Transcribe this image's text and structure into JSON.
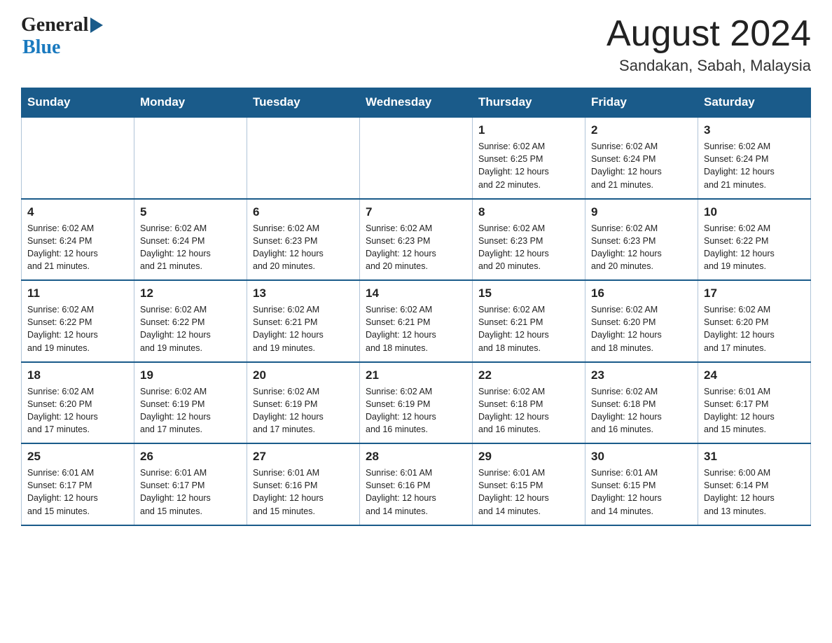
{
  "header": {
    "logo_general": "General",
    "logo_blue": "Blue",
    "month_year": "August 2024",
    "location": "Sandakan, Sabah, Malaysia"
  },
  "days_of_week": [
    "Sunday",
    "Monday",
    "Tuesday",
    "Wednesday",
    "Thursday",
    "Friday",
    "Saturday"
  ],
  "weeks": [
    {
      "days": [
        {
          "number": "",
          "info": ""
        },
        {
          "number": "",
          "info": ""
        },
        {
          "number": "",
          "info": ""
        },
        {
          "number": "",
          "info": ""
        },
        {
          "number": "1",
          "info": "Sunrise: 6:02 AM\nSunset: 6:25 PM\nDaylight: 12 hours\nand 22 minutes."
        },
        {
          "number": "2",
          "info": "Sunrise: 6:02 AM\nSunset: 6:24 PM\nDaylight: 12 hours\nand 21 minutes."
        },
        {
          "number": "3",
          "info": "Sunrise: 6:02 AM\nSunset: 6:24 PM\nDaylight: 12 hours\nand 21 minutes."
        }
      ]
    },
    {
      "days": [
        {
          "number": "4",
          "info": "Sunrise: 6:02 AM\nSunset: 6:24 PM\nDaylight: 12 hours\nand 21 minutes."
        },
        {
          "number": "5",
          "info": "Sunrise: 6:02 AM\nSunset: 6:24 PM\nDaylight: 12 hours\nand 21 minutes."
        },
        {
          "number": "6",
          "info": "Sunrise: 6:02 AM\nSunset: 6:23 PM\nDaylight: 12 hours\nand 20 minutes."
        },
        {
          "number": "7",
          "info": "Sunrise: 6:02 AM\nSunset: 6:23 PM\nDaylight: 12 hours\nand 20 minutes."
        },
        {
          "number": "8",
          "info": "Sunrise: 6:02 AM\nSunset: 6:23 PM\nDaylight: 12 hours\nand 20 minutes."
        },
        {
          "number": "9",
          "info": "Sunrise: 6:02 AM\nSunset: 6:23 PM\nDaylight: 12 hours\nand 20 minutes."
        },
        {
          "number": "10",
          "info": "Sunrise: 6:02 AM\nSunset: 6:22 PM\nDaylight: 12 hours\nand 19 minutes."
        }
      ]
    },
    {
      "days": [
        {
          "number": "11",
          "info": "Sunrise: 6:02 AM\nSunset: 6:22 PM\nDaylight: 12 hours\nand 19 minutes."
        },
        {
          "number": "12",
          "info": "Sunrise: 6:02 AM\nSunset: 6:22 PM\nDaylight: 12 hours\nand 19 minutes."
        },
        {
          "number": "13",
          "info": "Sunrise: 6:02 AM\nSunset: 6:21 PM\nDaylight: 12 hours\nand 19 minutes."
        },
        {
          "number": "14",
          "info": "Sunrise: 6:02 AM\nSunset: 6:21 PM\nDaylight: 12 hours\nand 18 minutes."
        },
        {
          "number": "15",
          "info": "Sunrise: 6:02 AM\nSunset: 6:21 PM\nDaylight: 12 hours\nand 18 minutes."
        },
        {
          "number": "16",
          "info": "Sunrise: 6:02 AM\nSunset: 6:20 PM\nDaylight: 12 hours\nand 18 minutes."
        },
        {
          "number": "17",
          "info": "Sunrise: 6:02 AM\nSunset: 6:20 PM\nDaylight: 12 hours\nand 17 minutes."
        }
      ]
    },
    {
      "days": [
        {
          "number": "18",
          "info": "Sunrise: 6:02 AM\nSunset: 6:20 PM\nDaylight: 12 hours\nand 17 minutes."
        },
        {
          "number": "19",
          "info": "Sunrise: 6:02 AM\nSunset: 6:19 PM\nDaylight: 12 hours\nand 17 minutes."
        },
        {
          "number": "20",
          "info": "Sunrise: 6:02 AM\nSunset: 6:19 PM\nDaylight: 12 hours\nand 17 minutes."
        },
        {
          "number": "21",
          "info": "Sunrise: 6:02 AM\nSunset: 6:19 PM\nDaylight: 12 hours\nand 16 minutes."
        },
        {
          "number": "22",
          "info": "Sunrise: 6:02 AM\nSunset: 6:18 PM\nDaylight: 12 hours\nand 16 minutes."
        },
        {
          "number": "23",
          "info": "Sunrise: 6:02 AM\nSunset: 6:18 PM\nDaylight: 12 hours\nand 16 minutes."
        },
        {
          "number": "24",
          "info": "Sunrise: 6:01 AM\nSunset: 6:17 PM\nDaylight: 12 hours\nand 15 minutes."
        }
      ]
    },
    {
      "days": [
        {
          "number": "25",
          "info": "Sunrise: 6:01 AM\nSunset: 6:17 PM\nDaylight: 12 hours\nand 15 minutes."
        },
        {
          "number": "26",
          "info": "Sunrise: 6:01 AM\nSunset: 6:17 PM\nDaylight: 12 hours\nand 15 minutes."
        },
        {
          "number": "27",
          "info": "Sunrise: 6:01 AM\nSunset: 6:16 PM\nDaylight: 12 hours\nand 15 minutes."
        },
        {
          "number": "28",
          "info": "Sunrise: 6:01 AM\nSunset: 6:16 PM\nDaylight: 12 hours\nand 14 minutes."
        },
        {
          "number": "29",
          "info": "Sunrise: 6:01 AM\nSunset: 6:15 PM\nDaylight: 12 hours\nand 14 minutes."
        },
        {
          "number": "30",
          "info": "Sunrise: 6:01 AM\nSunset: 6:15 PM\nDaylight: 12 hours\nand 14 minutes."
        },
        {
          "number": "31",
          "info": "Sunrise: 6:00 AM\nSunset: 6:14 PM\nDaylight: 12 hours\nand 13 minutes."
        }
      ]
    }
  ]
}
